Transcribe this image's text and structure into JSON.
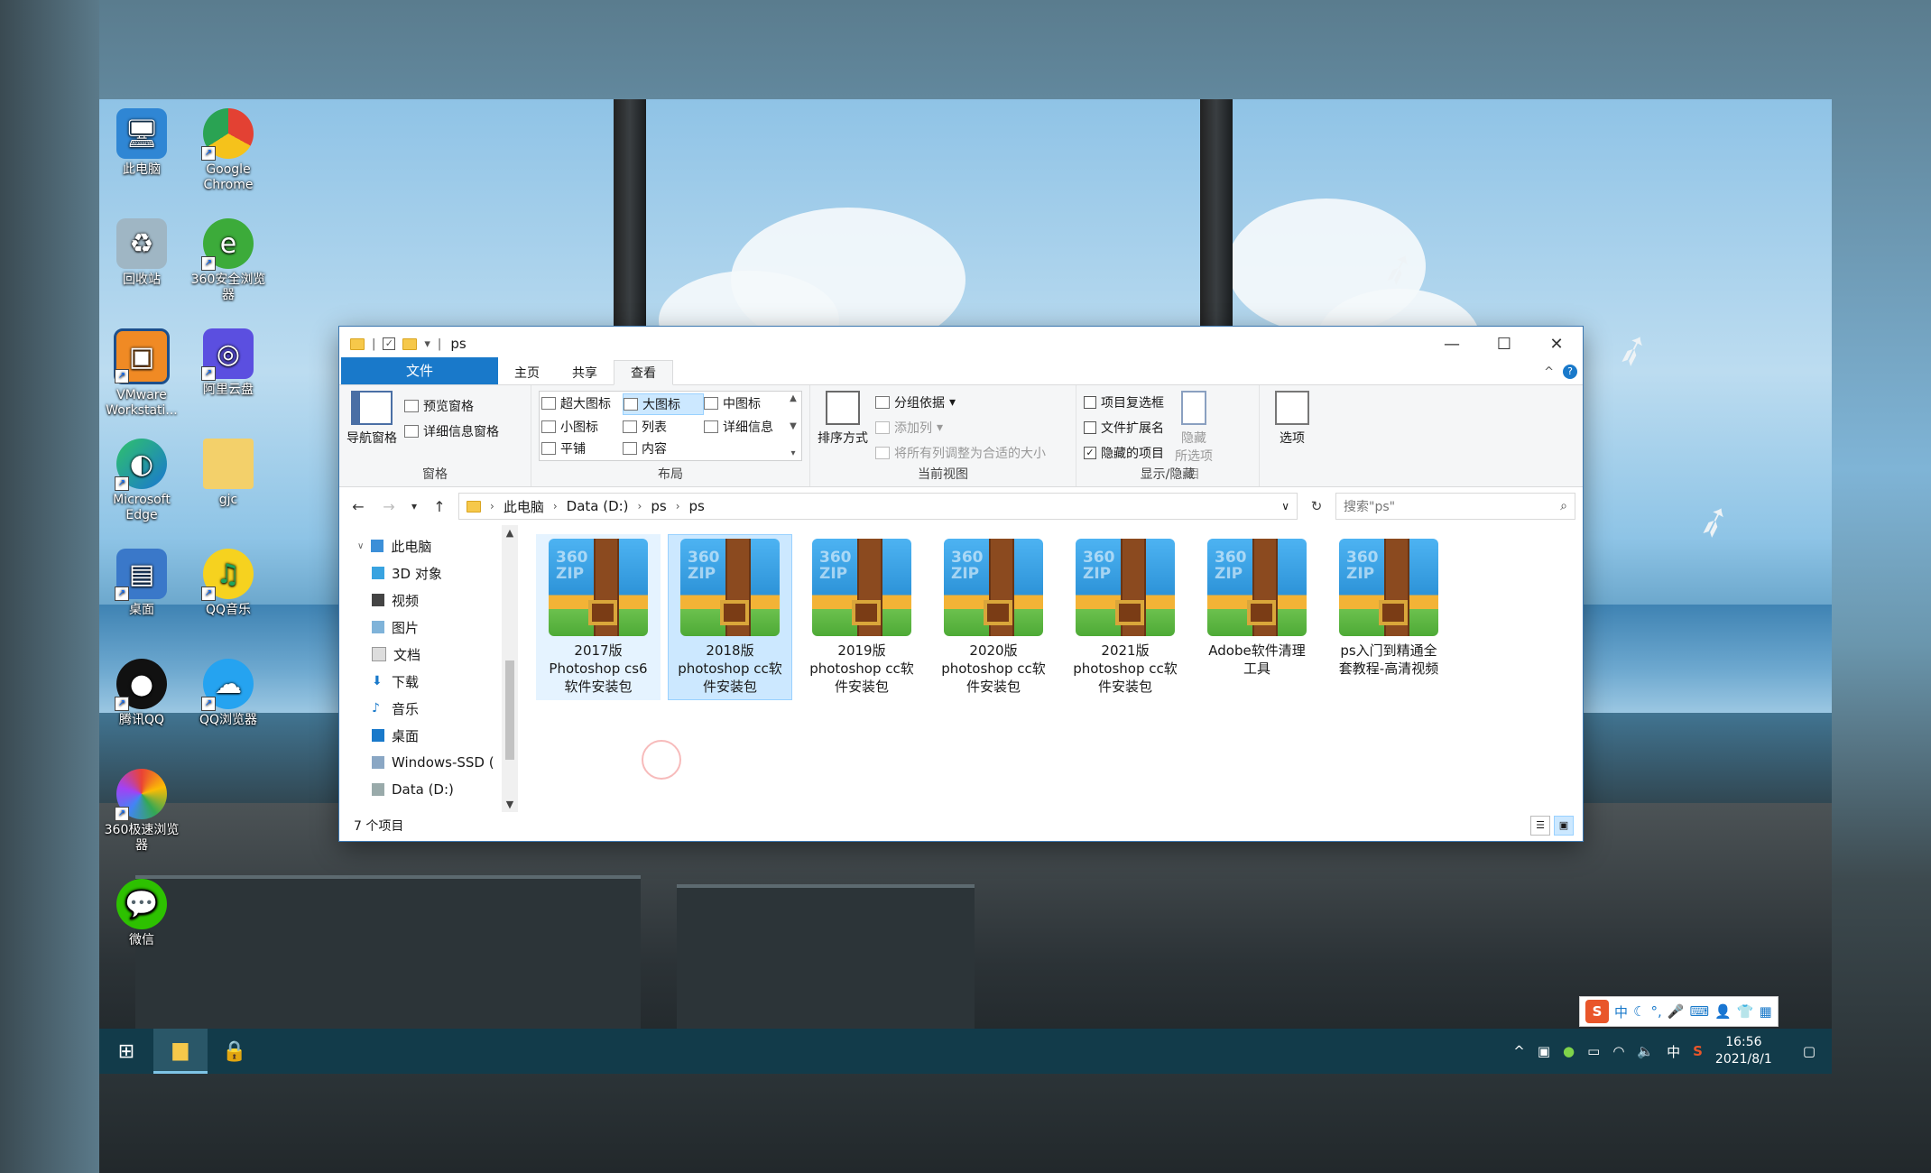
{
  "desktop": {
    "icons": [
      {
        "label": "此电脑",
        "icon": "computer-icon"
      },
      {
        "label": "Google Chrome",
        "icon": "chrome-icon"
      },
      {
        "label": "回收站",
        "icon": "recycle-bin-icon"
      },
      {
        "label": "360安全浏览器",
        "icon": "360-browser-icon"
      },
      {
        "label": "VMware Workstati...",
        "icon": "vmware-icon"
      },
      {
        "label": "阿里云盘",
        "icon": "aliyun-drive-icon"
      },
      {
        "label": "Microsoft Edge",
        "icon": "edge-icon"
      },
      {
        "label": "gjc",
        "icon": "folder-icon"
      },
      {
        "label": "桌面",
        "icon": "desktop-folder-icon"
      },
      {
        "label": "QQ音乐",
        "icon": "qq-music-icon"
      },
      {
        "label": "腾讯QQ",
        "icon": "qq-icon"
      },
      {
        "label": "QQ浏览器",
        "icon": "qq-browser-icon"
      },
      {
        "label": "360极速浏览器",
        "icon": "360-speed-browser-icon"
      },
      {
        "label": "微信",
        "icon": "wechat-icon"
      }
    ]
  },
  "explorer": {
    "title": "ps",
    "tabs": {
      "file": "文件",
      "home": "主页",
      "share": "共享",
      "view": "查看"
    },
    "ribbon": {
      "pane": {
        "nav_pane": "导航窗格",
        "preview_pane": "预览窗格",
        "details_pane": "详细信息窗格",
        "label": "窗格"
      },
      "layout": {
        "items": [
          "超大图标",
          "大图标",
          "中图标",
          "小图标",
          "列表",
          "详细信息",
          "平铺",
          "内容"
        ],
        "selected": "大图标",
        "label": "布局"
      },
      "current_view": {
        "sort_by": "排序方式",
        "group_by": "分组依据",
        "add_columns": "添加列",
        "size_columns": "将所有列调整为合适的大小",
        "label": "当前视图"
      },
      "show_hide": {
        "item_checkboxes": "项目复选框",
        "item_checkboxes_checked": false,
        "file_extensions": "文件扩展名",
        "file_extensions_checked": false,
        "hidden_items": "隐藏的项目",
        "hidden_items_checked": true,
        "hide_selected": "隐藏",
        "hide_selected_2": "所选项目",
        "label": "显示/隐藏"
      },
      "options": "选项"
    },
    "address": {
      "crumbs": [
        "此电脑",
        "Data (D:)",
        "ps",
        "ps"
      ],
      "search_placeholder": "搜索\"ps\""
    },
    "nav_pane": {
      "items": [
        "此电脑",
        "3D 对象",
        "视频",
        "图片",
        "文档",
        "下载",
        "音乐",
        "桌面",
        "Windows-SSD (",
        "Data (D:)"
      ]
    },
    "files": [
      {
        "line1": "2017版",
        "line2": "Photoshop cs6",
        "line3": "软件安装包"
      },
      {
        "line1": "2018版",
        "line2": "photoshop cc软",
        "line3": "件安装包"
      },
      {
        "line1": "2019版",
        "line2": "photoshop cc软",
        "line3": "件安装包"
      },
      {
        "line1": "2020版",
        "line2": "photoshop cc软",
        "line3": "件安装包"
      },
      {
        "line1": "2021版",
        "line2": "photoshop cc软",
        "line3": "件安装包"
      },
      {
        "line1": "Adobe软件清理",
        "line2": "工具",
        "line3": ""
      },
      {
        "line1": "ps入门到精通全",
        "line2": "套教程-高清视频",
        "line3": ""
      }
    ],
    "zip_badge": "360\nZIP",
    "status": "7 个项目"
  },
  "taskbar": {
    "time": "16:56",
    "date": "2021/8/1",
    "ime_lang": "中",
    "ime_bar_lang": "中"
  },
  "colors": {
    "accent": "#1979ca",
    "selection": "#cce8ff",
    "taskbar": "#123b4a"
  }
}
